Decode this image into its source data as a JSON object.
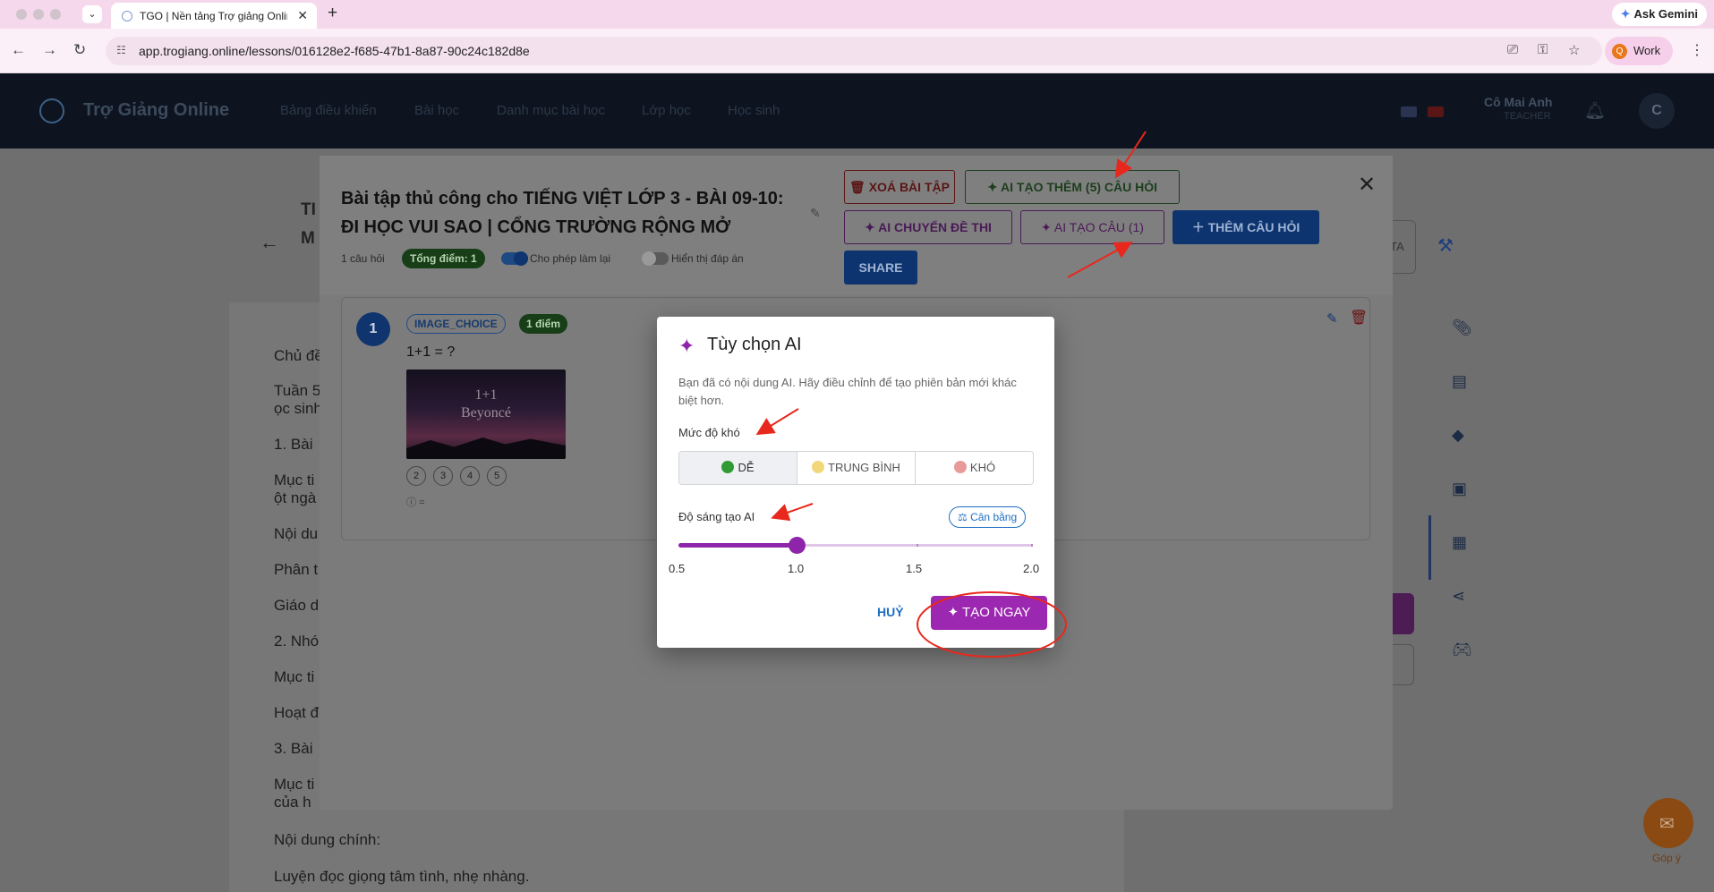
{
  "browser": {
    "tab_title": "TGO | Nền tảng Trợ giảng Online",
    "url": "app.trogiang.online/lessons/016128e2-f685-47b1-8a87-90c24c182d8e",
    "gemini_label": "Ask Gemini",
    "profile_initial": "Q",
    "profile_label": "Work"
  },
  "app": {
    "brand": "Trợ Giảng Online",
    "menu": [
      "Bảng điều khiển",
      "Bài học",
      "Danh mục bài học",
      "Lớp học",
      "Học sinh"
    ],
    "user_name": "Cô Mai Anh",
    "user_role": "TEACHER",
    "avatar_initial": "C"
  },
  "background": {
    "title_fragments": [
      "TI",
      "M"
    ],
    "lines": [
      "Chủ đề",
      "Tuần 5",
      "ọc sinh",
      "1. Bài",
      "Mục ti",
      "ột ngà",
      "Nội du",
      "Phân t",
      "Giáo d",
      "2. Nhó",
      "Mục ti",
      "Hoạt đ",
      "3. Bài",
      "Mục ti",
      " của h",
      "Nội dung chính:",
      "Luyện đọc giọng tâm tình, nhẹ nhàng."
    ],
    "top_box_text": "TA",
    "feedback_label": "Góp ý"
  },
  "modal": {
    "title": "Bài tập thủ công cho TIẾNG VIỆT LỚP 3 - BÀI 09-10: ĐI HỌC VUI SAO | CỔNG TRƯỜNG RỘNG MỞ",
    "question_count": "1 câu hỏi",
    "total_score": "Tổng điểm: 1",
    "allow_retry_label": "Cho phép làm lại",
    "allow_retry_on": true,
    "show_answer_label": "Hiển thị đáp án",
    "show_answer_on": false,
    "buttons": {
      "delete": "XOÁ BÀI TẬP",
      "ai_add_more": "AI TẠO THÊM (5) CÂU HỎI",
      "ai_convert": "AI CHUYỂN ĐỀ THI",
      "ai_create": "AI TẠO CÂU (1)",
      "add_question": "THÊM CÂU HỎI",
      "share": "SHARE"
    },
    "question": {
      "number": "1",
      "type": "IMAGE_CHOICE",
      "points": "1 điểm",
      "text": "1+1 = ?",
      "image_line1": "1+1",
      "image_line2": "Beyoncé",
      "options": [
        "2",
        "3",
        "4",
        "5"
      ],
      "help": "="
    }
  },
  "ai_dialog": {
    "title": "Tùy chọn AI",
    "description": "Bạn đã có nội dung AI. Hãy điều chỉnh để tạo phiên bản mới khác biệt hơn.",
    "difficulty_label": "Mức độ khó",
    "difficulty_options": [
      {
        "label": "DỄ",
        "color": "#2e9b35",
        "selected": true
      },
      {
        "label": "TRUNG BÌNH",
        "color": "#f2d77a",
        "selected": false
      },
      {
        "label": "KHÓ",
        "color": "#e89a9a",
        "selected": false
      }
    ],
    "creativity_label": "Độ sáng tạo AI",
    "balance_chip": "Cân bằng",
    "slider": {
      "min": 0.5,
      "max": 2.0,
      "value": 1.0
    },
    "ticks": [
      "0.5",
      "1.0",
      "1.5",
      "2.0"
    ],
    "cancel": "HUỶ",
    "create_now": "TẠO NGAY"
  },
  "colors": {
    "accent_purple": "#9c27b0",
    "primary_blue": "#1e6fc2",
    "annotation_red": "#e8281c"
  }
}
